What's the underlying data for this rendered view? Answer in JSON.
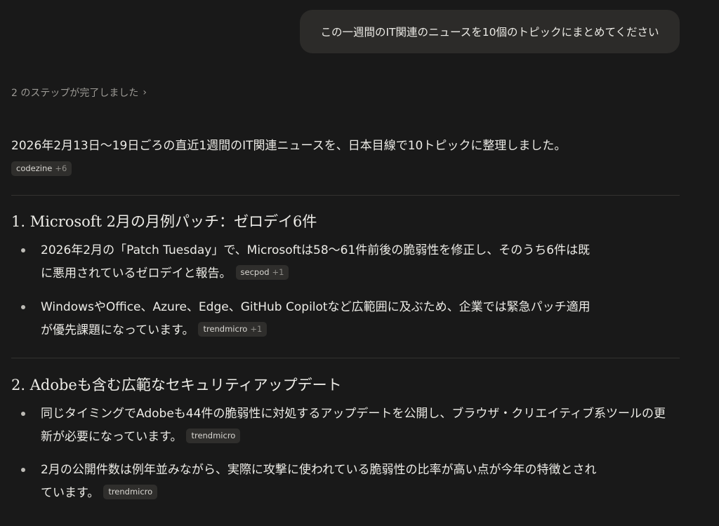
{
  "user_message": "この一週間のIT関連のニュースを10個のトピックにまとめてください",
  "steps": {
    "label": "2 のステップが完了しました",
    "chevron": "›"
  },
  "intro": {
    "text": "2026年2月13日～19日ごろの直近1週間のIT関連ニュースを、日本目線で10トピックに整理しました。",
    "chip": {
      "label": "codezine",
      "extra": "+6"
    }
  },
  "sections": [
    {
      "heading": "1. Microsoft 2月の月例パッチ：ゼロデイ6件",
      "bullets": [
        {
          "line1": "2026年2月の「Patch Tuesday」で、Microsoftは58～61件前後の脆弱性を修正し、そのうち6件は既",
          "line2": "に悪用されているゼロデイと報告。",
          "chip": {
            "label": "secpod",
            "extra": "+1"
          }
        },
        {
          "line1": "WindowsやOffice、Azure、Edge、GitHub Copilotなど広範囲に及ぶため、企業では緊急パッチ適用",
          "line2": "が優先課題になっています。",
          "chip": {
            "label": "trendmicro",
            "extra": "+1"
          }
        }
      ]
    },
    {
      "heading": "2. Adobeも含む広範なセキュリティアップデート",
      "bullets": [
        {
          "line1": "同じタイミングでAdobeも44件の脆弱性に対処するアップデートを公開し、ブラウザ・クリエイティブ系ツールの更",
          "line2": "新が必要になっています。",
          "chip": {
            "label": "trendmicro",
            "extra": ""
          }
        },
        {
          "line1": "2月の公開件数は例年並みながら、実際に攻撃に使われている脆弱性の比率が高い点が今年の特徴とされ",
          "line2": "ています。",
          "chip": {
            "label": "trendmicro",
            "extra": ""
          }
        }
      ]
    }
  ]
}
